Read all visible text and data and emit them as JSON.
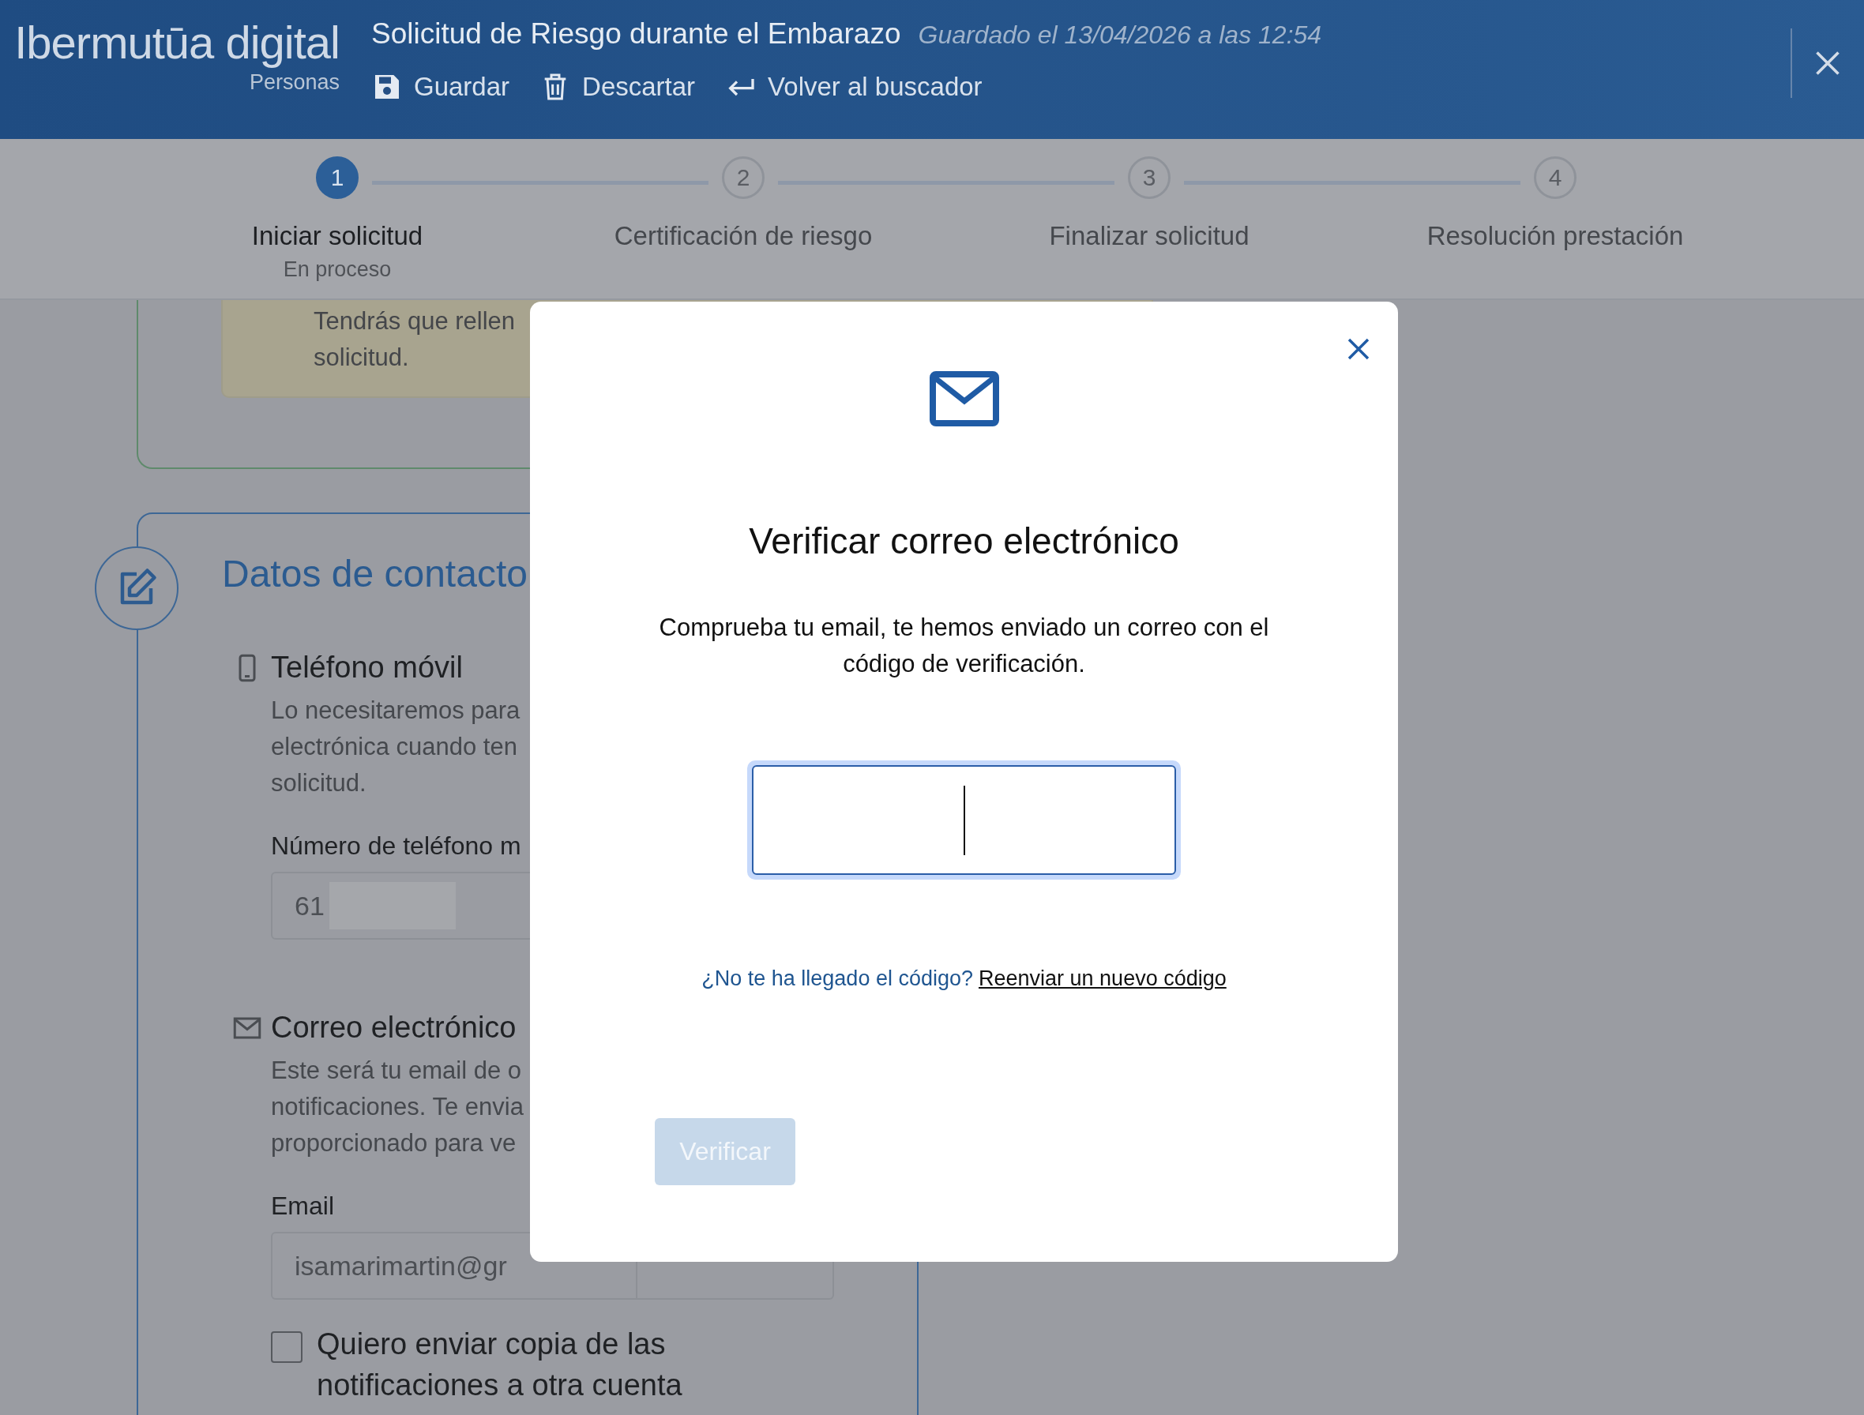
{
  "header": {
    "logo": "Ibermutūa **digital**",
    "logo_subtitle": "Personas",
    "title": "Solicitud de Riesgo durante el Embarazo",
    "saved_note": "Guardado el 13/04/2026 a las 12:54",
    "actions": [
      {
        "kind": "save",
        "label": "Guardar"
      },
      {
        "kind": "trash",
        "label": "Descartar"
      },
      {
        "kind": "back",
        "label": "Volver al buscador"
      }
    ]
  },
  "stepper": {
    "steps": [
      {
        "number": "1",
        "label": "Iniciar solicitud",
        "status": "En proceso",
        "selected": true
      },
      {
        "number": "2",
        "label": "Certificación de riesgo",
        "selected": false
      },
      {
        "number": "3",
        "label": "Finalizar solicitud",
        "selected": false
      },
      {
        "number": "4",
        "label": "Resolución prestación",
        "selected": false
      }
    ]
  },
  "form": {
    "notice": "Tendrás que rellen\nsolicitud.",
    "section_title": "Datos de contacto",
    "groups": [
      {
        "kind": "phone",
        "title": "Teléfono móvil",
        "description": "Lo necesitaremos para\nelectrónica cuando ten\nsolicitud.",
        "field_label": "Número de teléfono m",
        "value": "61"
      },
      {
        "kind": "mail",
        "title": "Correo electrónico",
        "description": "Este será tu email de o\nnotificaciones. Te envia\nproporcionado para ve",
        "field_label": "Email",
        "value": "isamarimartin@gr"
      }
    ],
    "copy_checkbox": {
      "label": "Quiero enviar copia de las notificaciones a otra cuenta",
      "checked": false
    }
  },
  "dialog": {
    "title": "Verificar correo electrónico",
    "message": "Comprueba tu email, te hemos enviado un correo con el\ncódigo de verificación.",
    "code_field": {
      "focused": true
    },
    "link_prompt": "¿No te ha llegado el código?",
    "link": "Reenviar un nuevo código",
    "button": {
      "label": "Verificar",
      "disabled": true
    }
  }
}
